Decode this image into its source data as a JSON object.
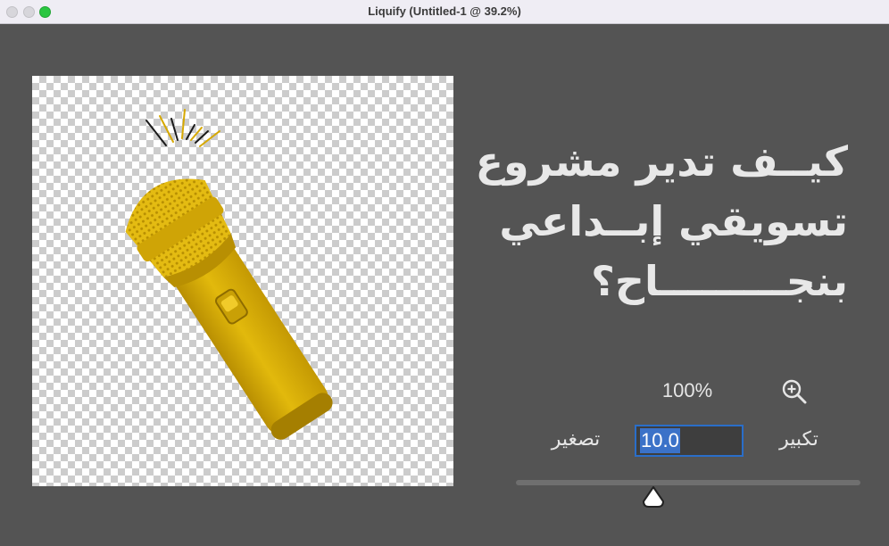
{
  "window": {
    "title": "Liquify (Untitled-1 @ 39.2%)"
  },
  "canvas": {
    "artwork": "yellow-microphone"
  },
  "headline": {
    "lines": [
      "كيــف تدير مشروع",
      "تسويقي إبــداعي",
      "بنجـــــــــاح؟"
    ]
  },
  "zoom": {
    "percent": "100%",
    "zoom_in_icon": "zoom-in-icon"
  },
  "brush": {
    "shrink_label": "تصغير",
    "grow_label": "تكبير",
    "size_value": "10.0",
    "slider_level": 0.36
  },
  "colors": {
    "background": "#545454",
    "accent": "#2a6ec9",
    "microphone": "#d9ae06"
  }
}
